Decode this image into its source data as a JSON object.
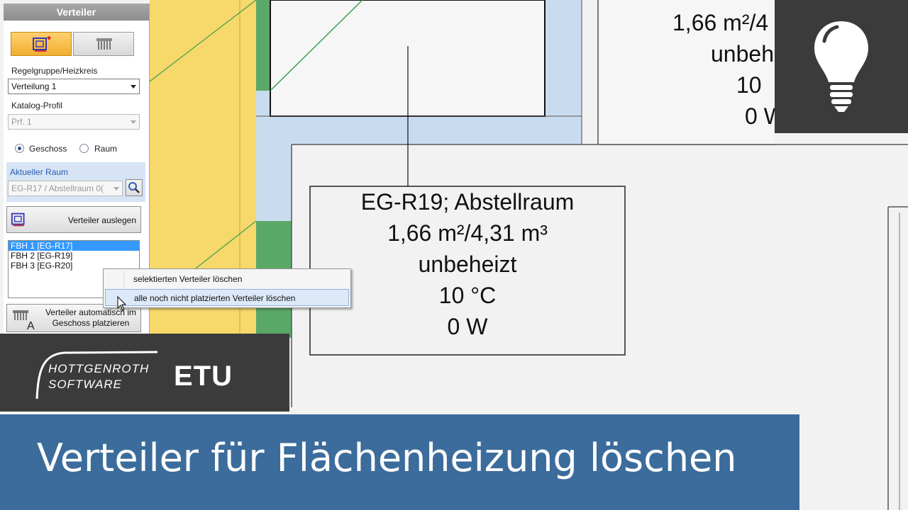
{
  "panel": {
    "title": "Verteiler",
    "mode_buttons": [
      {
        "icon": "manifold-heat-icon",
        "active": true
      },
      {
        "icon": "radiator-icon",
        "active": false
      }
    ],
    "regelgruppe_label": "Regelgruppe/Heizkreis",
    "regelgruppe_value": "Verteilung 1",
    "katalog_label": "Katalog-Profil",
    "katalog_value": "Prf. 1",
    "radio_geschoss": "Geschoss",
    "radio_raum": "Raum",
    "radio_selected": "Geschoss",
    "aktueller_raum_label": "Aktueller Raum",
    "aktueller_raum_value": "EG-R17 / Abstellraum 0(",
    "auslegen_button": "Verteiler auslegen",
    "list_items": [
      "FBH 1 [EG-R17]",
      "FBH 2 [EG-R19]",
      "FBH 3 [EG-R20]"
    ],
    "list_selected": 0,
    "auto_button_line1": "Verteiler automatisch im",
    "auto_button_line2": "Geschoss platzieren"
  },
  "context_menu": {
    "items": [
      "selektierten Verteiler löschen",
      "alle noch nicht platzierten Verteiler löschen"
    ],
    "highlighted": 1
  },
  "rooms": {
    "main": {
      "name": "EG-R19; Abstellraum",
      "area_volume": "1,66 m²/4,31 m³",
      "status": "unbeheizt",
      "temperature": "10 °C",
      "power": "0 W"
    },
    "top_right": {
      "area_volume": "1,66 m²/4",
      "status": "unbeh",
      "temperature": "10",
      "power": "0 W"
    }
  },
  "logo": {
    "brand_line1": "HOTTGENROTH",
    "brand_line2": "SOFTWARE",
    "product": "ETU"
  },
  "banner": {
    "title": "Verteiler für Flächenheizung löschen"
  },
  "colors": {
    "banner_bg": "#3b6c9c",
    "wall_yellow": "#f7d86a",
    "wall_green": "#5aa867",
    "heated_blue": "#c9dcef",
    "highlight_orange": "#f0b030"
  }
}
